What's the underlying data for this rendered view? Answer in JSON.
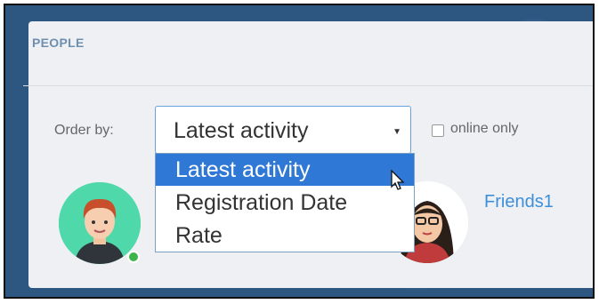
{
  "panel": {
    "title": "PEOPLE"
  },
  "order": {
    "label": "Order by:",
    "selected_value": "Latest activity",
    "options": [
      "Latest activity",
      "Registration Date",
      "Rate"
    ]
  },
  "online_filter": {
    "label": "online only",
    "checked": false
  },
  "friends": {
    "label": "Friends1"
  },
  "icons": {
    "dropdown_caret": "chevron-down-icon",
    "cursor": "pointer-cursor-icon"
  },
  "colors": {
    "accent": "#2f78d6",
    "link": "#3d8fd8",
    "online_status": "#3cb54a",
    "panel_background": "#eef0f3"
  }
}
